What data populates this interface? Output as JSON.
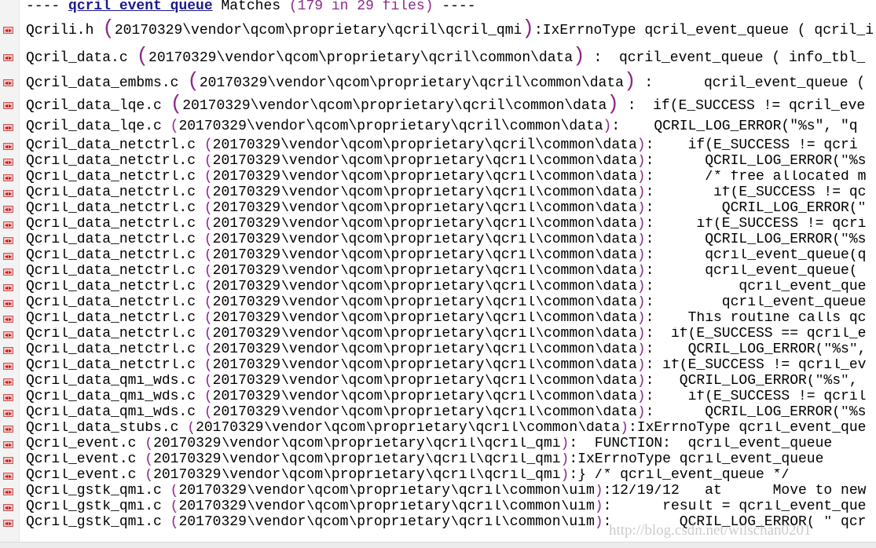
{
  "header": {
    "prefix": "---- ",
    "keyword": "qcril_event_queue",
    "middle": " Matches ",
    "count": "(179 in 29 files)",
    "suffix": " ----"
  },
  "rows": [
    {
      "file": "Qcrili.h",
      "path": "20170329\\vendor\\qcom\\proprietary\\qcril\\qcril_qmi",
      "text": ":IxErrnoType qcril_event_queue ( qcril_i"
    },
    {
      "file": "Qcril_data.c",
      "path": "20170329\\vendor\\qcom\\proprietary\\qcril\\common\\data",
      "text": " :  qcril_event_queue ( info_tbl_"
    },
    {
      "file": "Qcril_data_embms.c",
      "path": "20170329\\vendor\\qcom\\proprietary\\qcril\\common\\data",
      "text": " :      qcril_event_queue ("
    },
    {
      "file": "Qcril_data_lqe.c",
      "path": "20170329\\vendor\\qcom\\proprietary\\qcril\\common\\data",
      "text": " :  if(E_SUCCESS != qcril_eve"
    },
    {
      "file": "Qcril_data_lqe.c",
      "path": "20170329\\vendor\\qcom\\proprietary\\qcril\\common\\data",
      "text": ":    QCRIL_LOG_ERROR(\"%s\", \"q"
    },
    {
      "file": "Qcril_data_netctrl.c",
      "path": "20170329\\vendor\\qcom\\proprietary\\qcril\\common\\data",
      "text": ":    if(E_SUCCESS != qcri"
    },
    {
      "file": "Qcril_data_netctrl.c",
      "path": "20170329\\vendor\\qcom\\proprietary\\qcril\\common\\data",
      "text": ":      QCRIL_LOG_ERROR(\"%s"
    },
    {
      "file": "Qcril_data_netctrl.c",
      "path": "20170329\\vendor\\qcom\\proprietary\\qcril\\common\\data",
      "text": ":      /* free allocated m"
    },
    {
      "file": "Qcril_data_netctrl.c",
      "path": "20170329\\vendor\\qcom\\proprietary\\qcril\\common\\data",
      "text": ":       if(E_SUCCESS != qc"
    },
    {
      "file": "Qcril_data_netctrl.c",
      "path": "20170329\\vendor\\qcom\\proprietary\\qcril\\common\\data",
      "text": ":        QCRIL_LOG_ERROR(\""
    },
    {
      "file": "Qcril_data_netctrl.c",
      "path": "20170329\\vendor\\qcom\\proprietary\\qcril\\common\\data",
      "text": ":     if(E_SUCCESS != qcri"
    },
    {
      "file": "Qcril_data_netctrl.c",
      "path": "20170329\\vendor\\qcom\\proprietary\\qcril\\common\\data",
      "text": ":      QCRIL_LOG_ERROR(\"%s"
    },
    {
      "file": "Qcril_data_netctrl.c",
      "path": "20170329\\vendor\\qcom\\proprietary\\qcril\\common\\data",
      "text": ":      qcril_event_queue(q"
    },
    {
      "file": "Qcril_data_netctrl.c",
      "path": "20170329\\vendor\\qcom\\proprietary\\qcril\\common\\data",
      "text": ":      qcril_event_queue("
    },
    {
      "file": "Qcril_data_netctrl.c",
      "path": "20170329\\vendor\\qcom\\proprietary\\qcril\\common\\data",
      "text": ":          qcril_event_que"
    },
    {
      "file": "Qcril_data_netctrl.c",
      "path": "20170329\\vendor\\qcom\\proprietary\\qcril\\common\\data",
      "text": ":        qcril_event_queue"
    },
    {
      "file": "Qcril_data_netctrl.c",
      "path": "20170329\\vendor\\qcom\\proprietary\\qcril\\common\\data",
      "text": ":    This routine calls qc"
    },
    {
      "file": "Qcril_data_netctrl.c",
      "path": "20170329\\vendor\\qcom\\proprietary\\qcril\\common\\data",
      "text": ":  if(E_SUCCESS == qcril_e"
    },
    {
      "file": "Qcril_data_netctrl.c",
      "path": "20170329\\vendor\\qcom\\proprietary\\qcril\\common\\data",
      "text": ":    QCRIL_LOG_ERROR(\"%s\","
    },
    {
      "file": "Qcril_data_netctrl.c",
      "path": "20170329\\vendor\\qcom\\proprietary\\qcril\\common\\data",
      "text": ": if(E_SUCCESS != qcril_ev"
    },
    {
      "file": "Qcril_data_qmi_wds.c",
      "path": "20170329\\vendor\\qcom\\proprietary\\qcril\\common\\data",
      "text": ":   QCRIL_LOG_ERROR(\"%s\","
    },
    {
      "file": "Qcril_data_qmi_wds.c",
      "path": "20170329\\vendor\\qcom\\proprietary\\qcril\\common\\data",
      "text": ":    if(E_SUCCESS != qcril"
    },
    {
      "file": "Qcril_data_qmi_wds.c",
      "path": "20170329\\vendor\\qcom\\proprietary\\qcril\\common\\data",
      "text": ":      QCRIL_LOG_ERROR(\"%s"
    },
    {
      "file": "Qcril_data_stubs.c",
      "path": "20170329\\vendor\\qcom\\proprietary\\qcril\\common\\data",
      "text": ":IxErrnoType qcril_event_que"
    },
    {
      "file": "Qcril_event.c",
      "path": "20170329\\vendor\\qcom\\proprietary\\qcril\\qcril_qmi",
      "text": ":  FUNCTION:  qcril_event_queue"
    },
    {
      "file": "Qcril_event.c",
      "path": "20170329\\vendor\\qcom\\proprietary\\qcril\\qcril_qmi",
      "text": ":IxErrnoType qcril_event_queue"
    },
    {
      "file": "Qcril_event.c",
      "path": "20170329\\vendor\\qcom\\proprietary\\qcril\\qcril_qmi",
      "text": ":} /* qcril_event_queue */"
    },
    {
      "file": "Qcril_gstk_qmi.c",
      "path": "20170329\\vendor\\qcom\\proprietary\\qcril\\common\\uim",
      "text": ":12/19/12   at      Move to new"
    },
    {
      "file": "Qcril_gstk_qmi.c",
      "path": "20170329\\vendor\\qcom\\proprietary\\qcril\\common\\uim",
      "text": ":      result = qcril_event_que"
    },
    {
      "file": "Qcril_gstk_qmi.c",
      "path": "20170329\\vendor\\qcom\\proprietary\\qcril\\common\\uim",
      "text": ":        QCRIL_LOG_ERROR( \" qcr"
    }
  ],
  "watermark": "http://blog.csdn.net/wilschan0201",
  "icons": {
    "row": "jump-to-match-icon"
  },
  "colors": {
    "paren": "#8a2a8a",
    "keyword": "#1a1a8a"
  }
}
